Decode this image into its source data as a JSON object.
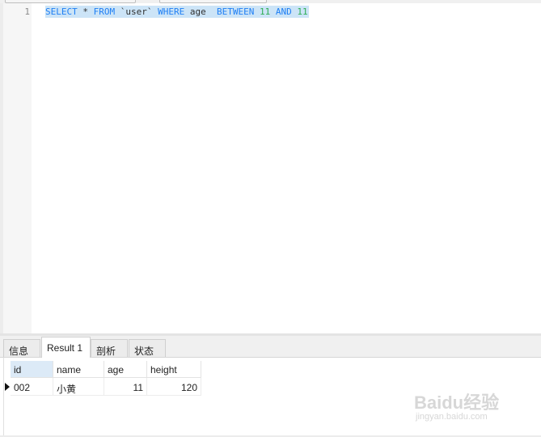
{
  "editor": {
    "line_number": "1",
    "sql": {
      "select": "SELECT",
      "star": "*",
      "from": "FROM",
      "table": "`user`",
      "where": "WHERE",
      "column": "age",
      "between": "BETWEEN",
      "low": "11",
      "and": "AND",
      "high": "11"
    }
  },
  "tabs": [
    {
      "label": "信息"
    },
    {
      "label": "Result 1"
    },
    {
      "label": "剖析"
    },
    {
      "label": "状态"
    }
  ],
  "result": {
    "columns": [
      "id",
      "name",
      "age",
      "height"
    ],
    "rows": [
      [
        "002",
        "小黄",
        "11",
        "120"
      ]
    ]
  },
  "watermark": {
    "logo": "Baidu经验",
    "url": "jingyan.baidu.com"
  },
  "colors": {
    "keyword": "#1e7ff5",
    "number": "#2fae55",
    "selection": "#cce4f7"
  }
}
